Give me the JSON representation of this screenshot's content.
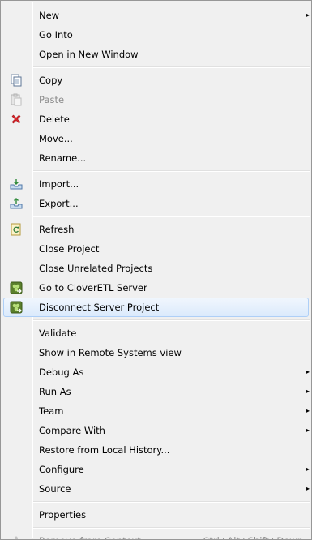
{
  "menu": {
    "new": "New",
    "go_into": "Go Into",
    "open_new_window": "Open in New Window",
    "copy": "Copy",
    "paste": "Paste",
    "delete": "Delete",
    "move": "Move...",
    "rename": "Rename...",
    "import": "Import...",
    "export": "Export...",
    "refresh": "Refresh",
    "close_project": "Close Project",
    "close_unrelated": "Close Unrelated Projects",
    "go_to_server": "Go to CloverETL Server",
    "disconnect_server": "Disconnect Server Project",
    "validate": "Validate",
    "show_remote": "Show in Remote Systems view",
    "debug_as": "Debug As",
    "run_as": "Run As",
    "team": "Team",
    "compare_with": "Compare With",
    "restore_history": "Restore from Local History...",
    "configure": "Configure",
    "source": "Source",
    "properties": "Properties",
    "remove_context": "Remove from Context",
    "remove_context_shortcut": "Ctrl+Alt+Shift+Down"
  },
  "icons": {
    "copy": "copy-icon",
    "paste": "paste-icon",
    "delete": "delete-icon",
    "import": "import-icon",
    "export": "export-icon",
    "refresh": "refresh-icon",
    "server": "clover-server-icon",
    "remove_context": "remove-context-icon"
  },
  "colors": {
    "menu_background": "#f0f0f0",
    "highlight_border": "#aecff7",
    "disabled_text": "#8d8d8d",
    "delete_icon": "#d9262b"
  },
  "submenu_arrow": "▸"
}
